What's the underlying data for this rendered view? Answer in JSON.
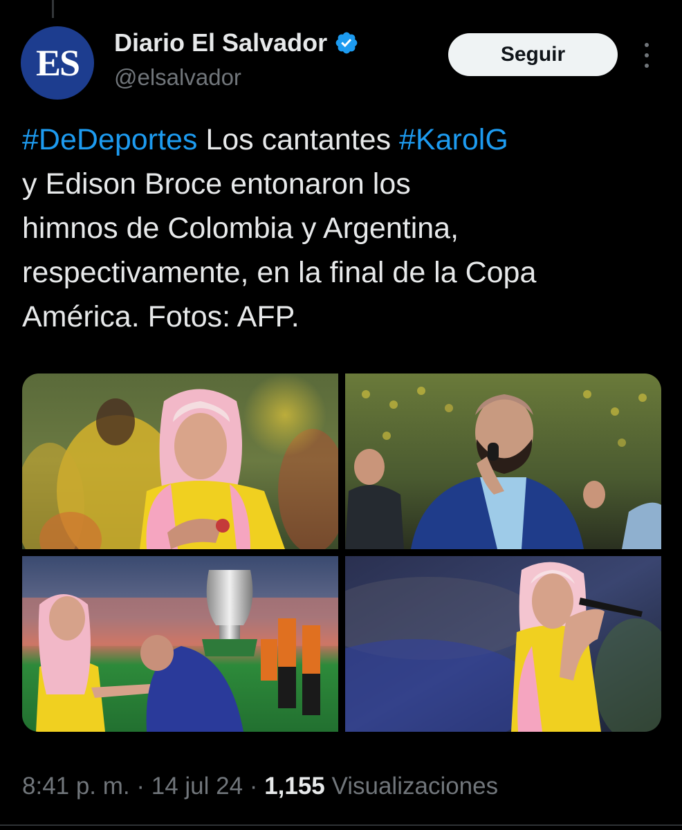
{
  "author": {
    "avatar_text": "ES",
    "display_name": "Diario El Salvador",
    "handle": "@elsalvador",
    "verified_icon": "verified-badge-icon",
    "verified_color": "#1d9bf0"
  },
  "follow_button_label": "Seguir",
  "more_menu_icon": "more-vertical-icon",
  "tweet": {
    "segments": [
      {
        "text": "#DeDeportes",
        "type": "hashtag"
      },
      {
        "text": " Los cantantes ",
        "type": "text"
      },
      {
        "text": "#KarolG",
        "type": "hashtag"
      },
      {
        "text": "\ny Edison Broce entonaron los\nhimnos de Colombia y Argentina,\nrespectivamente, en la final de la Copa\nAmérica. Fotos: AFP.",
        "type": "text"
      }
    ],
    "hashtag_color": "#1d9bf0"
  },
  "media": [
    {
      "name": "photo-karol-g-hand-on-heart"
    },
    {
      "name": "photo-edison-broce-singing"
    },
    {
      "name": "photo-trophy-greeting"
    },
    {
      "name": "photo-karol-g-singing"
    }
  ],
  "meta": {
    "time": "8:41 p. m.",
    "separator": " · ",
    "date": "14 jul 24",
    "views_count": "1,155",
    "views_label": " Visualizaciones"
  },
  "colors": {
    "background": "#000000",
    "text_primary": "#e7e9ea",
    "text_secondary": "#71767b",
    "accent": "#1d9bf0"
  }
}
